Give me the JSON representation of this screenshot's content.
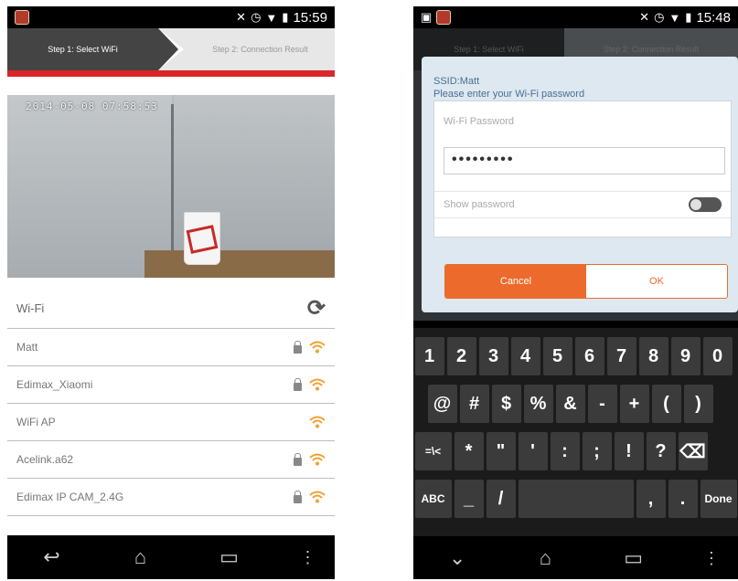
{
  "left_screen": {
    "status": {
      "time": "15:59"
    },
    "steps": {
      "step1": "Step 1: Select WiFi",
      "step2": "Step 2: Connection Result"
    },
    "camera": {
      "timestamp": "2014-05-08 07:58:53",
      "cup_label": "EDIMAX"
    },
    "wifi": {
      "header": "Wi-Fi",
      "networks": [
        {
          "ssid": "Matt",
          "locked": true
        },
        {
          "ssid": "Edimax_Xiaomi",
          "locked": true
        },
        {
          "ssid": "WiFi AP",
          "locked": false
        },
        {
          "ssid": "Acelink.a62",
          "locked": true
        },
        {
          "ssid": "Edimax IP CAM_2.4G",
          "locked": true
        }
      ]
    },
    "navbar": {
      "back": "↩",
      "home": "⌂",
      "recents": "▭",
      "menu": "⋮"
    }
  },
  "right_screen": {
    "status": {
      "time": "15:48"
    },
    "steps": {
      "step1": "Step 1: Select WiFi",
      "step2": "Step 2: Connection Result"
    },
    "dialog": {
      "ssid": "SSID:Matt",
      "prompt": "Please enter your Wi-Fi password",
      "field_label": "Wi-Fi Password",
      "field_value": "•••••••••",
      "show_password": "Show password",
      "cancel": "Cancel",
      "ok": "OK"
    },
    "keyboard": {
      "row1": [
        "1",
        "2",
        "3",
        "4",
        "5",
        "6",
        "7",
        "8",
        "9",
        "0"
      ],
      "row2": [
        "@",
        "#",
        "$",
        "%",
        "&",
        "-",
        "+",
        "(",
        ")"
      ],
      "row3": [
        "=\\<",
        "*",
        "\"",
        "'",
        ":",
        ";",
        "!",
        "?",
        "⌫"
      ],
      "row4": [
        "ABC",
        "_",
        "/",
        " ",
        ",",
        ".",
        "Done"
      ],
      "nav": {
        "back": "⌄",
        "home": "⌂",
        "recents": "▭",
        "menu": "⋮"
      }
    }
  },
  "colors": {
    "accent_red": "#d9262a",
    "accent_orange": "#ec6a2b",
    "wifi_orange": "#f0a030"
  }
}
